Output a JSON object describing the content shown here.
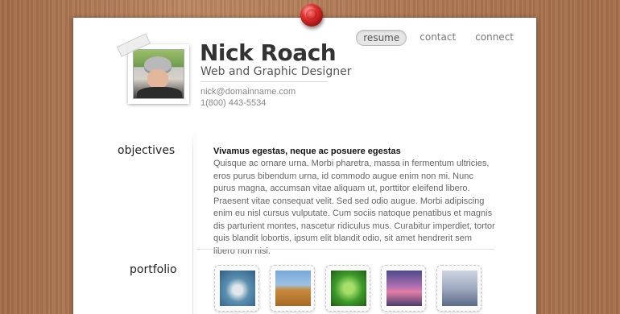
{
  "nav": {
    "items": [
      {
        "label": "resume",
        "active": true
      },
      {
        "label": "contact",
        "active": false
      },
      {
        "label": "connect",
        "active": false
      }
    ]
  },
  "header": {
    "name": "Nick Roach",
    "title": "Web and Graphic Designer",
    "email": "nick@domainname.com",
    "phone": "1(800) 443-5534"
  },
  "sections": {
    "objectives_label": "objectives",
    "portfolio_label": "portfolio"
  },
  "objectives": {
    "heading": "Vivamus egestas, neque ac posuere egestas",
    "text": "Quisque ac ornare urna. Morbi pharetra, massa in fermentum ultricies, eros purus bibendum urna, id commodo augue enim non mi. Nunc purus magna, accumsan vitae aliquam ut, porttitor eleifend libero. Praesent vitae consequat velit. Sed sed odio augue. Morbi adipiscing enim eu nisl cursus vulputate. Cum sociis natoque penatibus et magnis dis parturient montes, nascetur ridiculus mus. Curabitur imperdiet, tortor quis blandit lobortis, ipsum elit blandit odio, sit amet hendrerit sem libero non nisi."
  },
  "portfolio": {
    "thumbnails": [
      "dandelion",
      "wheat-field",
      "green-leaves",
      "bridge-sunset",
      "pier-dock"
    ]
  },
  "colors": {
    "pin": "#d42a2a",
    "wood": "#b07a55",
    "paper": "#ffffff"
  }
}
